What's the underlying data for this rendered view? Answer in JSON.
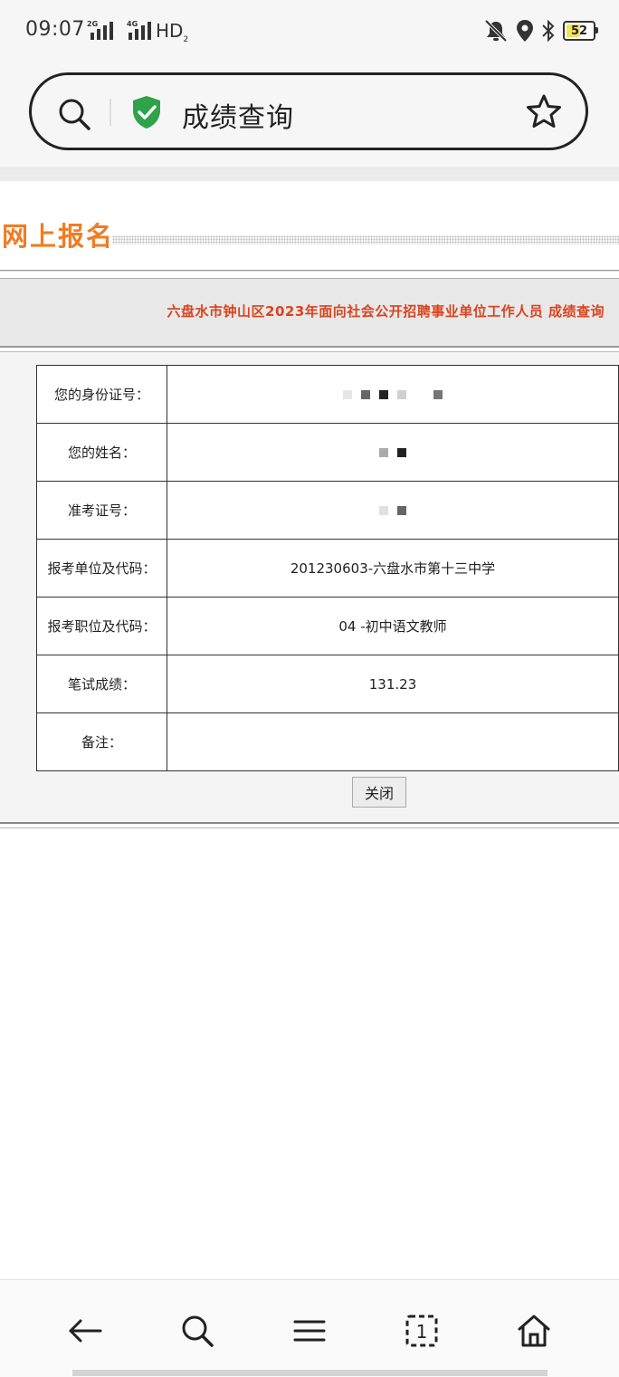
{
  "status_bar": {
    "time": "09:07",
    "network_1": "2G",
    "network_2": "4G",
    "hd_label": "HD",
    "hd_sub": "2",
    "battery": "52",
    "battery_level": 0.52,
    "icons": [
      "signal-icon",
      "mute-icon",
      "location-icon",
      "bluetooth-icon",
      "battery-icon"
    ]
  },
  "address_bar": {
    "title": "成绩查询",
    "icons": [
      "search-icon",
      "shield-check-icon",
      "star-icon"
    ]
  },
  "page": {
    "heading": "网上报名",
    "banner": "六盘水市钟山区2023年面向社会公开招聘事业单位工作人员 成绩查询",
    "rows": [
      {
        "label": "您的身份证号：",
        "value": ""
      },
      {
        "label": "您的姓名：",
        "value": ""
      },
      {
        "label": "准考证号：",
        "value": ""
      },
      {
        "label": "报考单位及代码：",
        "value": "201230603-六盘水市第十三中学"
      },
      {
        "label": "报考职位及代码：",
        "value": "04 -初中语文教师"
      },
      {
        "label": "笔试成绩：",
        "value": "131.23"
      },
      {
        "label": "备注：",
        "value": ""
      }
    ],
    "close_button": "关闭"
  },
  "bottom_nav": {
    "tabs_count": "1",
    "icons": [
      "back-arrow-icon",
      "search-icon",
      "menu-icon",
      "tabs-icon",
      "home-icon"
    ]
  },
  "colors": {
    "heading": "#f07c24",
    "banner_text": "#d9441f",
    "shield": "#2fa24a",
    "battery_fill": "#f2e35a"
  }
}
